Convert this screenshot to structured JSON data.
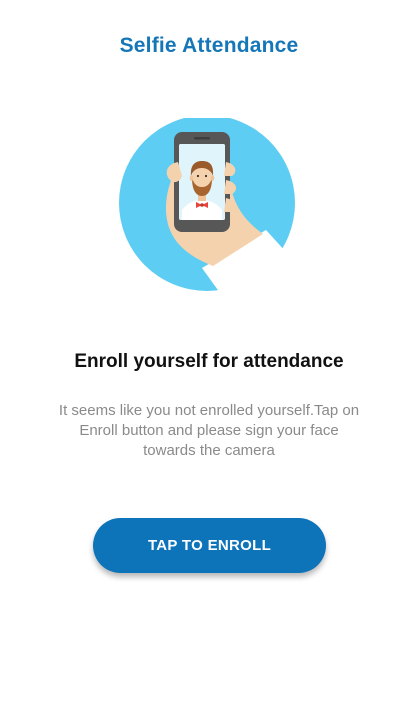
{
  "app": {
    "title": "Selfie Attendance"
  },
  "illustration": {
    "icon": "selfie-phone-illustration",
    "circle_color": "#5ecdf3"
  },
  "content": {
    "heading": "Enroll yourself for attendance",
    "description": "It seems like you not enrolled yourself.Tap on Enroll button and please sign your face towards the camera"
  },
  "actions": {
    "enroll_label": "TAP TO ENROLL",
    "button_color": "#0d74ba"
  },
  "colors": {
    "title": "#1677b8",
    "heading": "#111111",
    "description": "#8a8a8a"
  }
}
